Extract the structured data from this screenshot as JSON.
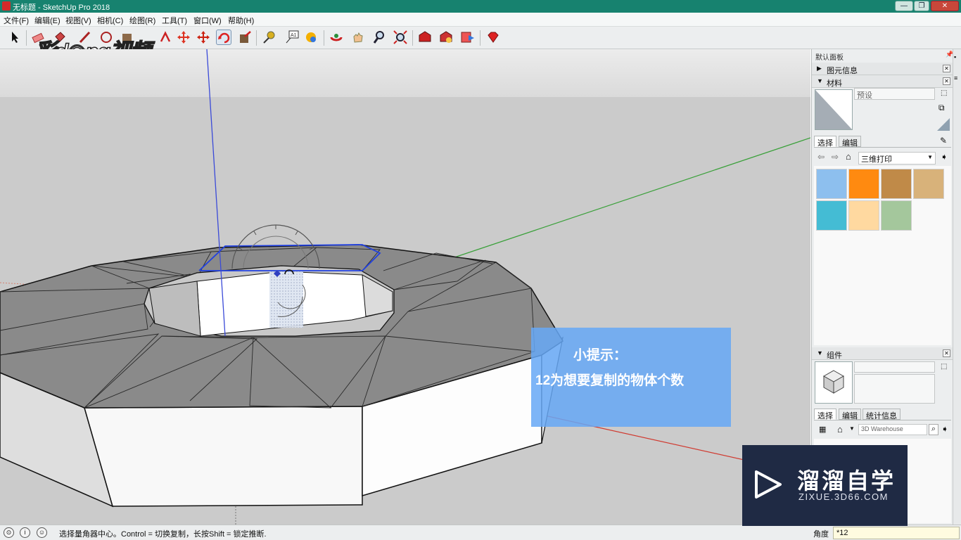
{
  "window": {
    "title": "无标题 - SketchUp Pro 2018",
    "controls": [
      "—",
      "❐",
      "✕"
    ]
  },
  "menu": [
    "文件(F)",
    "编辑(E)",
    "视图(V)",
    "相机(C)",
    "绘图(R)",
    "工具(T)",
    "窗口(W)",
    "帮助(H)"
  ],
  "toolbar": {
    "icons": [
      "select-icon",
      "eraser-icon",
      "paint-bucket-icon",
      "line-icon",
      "rectangle-icon",
      "push-pull-icon",
      "follow-me-icon",
      "move-icon",
      "rotate-icon",
      "scale-icon",
      "tape-measure-icon",
      "text-icon",
      "paint-icon",
      "orbit-icon",
      "pan-icon",
      "zoom-icon",
      "zoom-extents-icon",
      "warehouse-icon",
      "extension-warehouse-icon",
      "send-to-layout-icon",
      "ruby-icon"
    ],
    "active": "rotate-icon"
  },
  "watermark_top": "彩d◉ng视频",
  "tip": {
    "title": "小提示：",
    "text": "12为想要复制的物体个数"
  },
  "tray": {
    "title": "默认面板",
    "entity_info": {
      "label": "图元信息",
      "expanded": false
    },
    "materials": {
      "label": "材料",
      "expanded": true,
      "name_placeholder": "预设",
      "tabs": [
        "选择",
        "编辑"
      ],
      "selected_tab": "选择",
      "collection": "三维打印",
      "swatches": [
        "#8dbfee",
        "#ff8a10",
        "#c08a48",
        "#d8b27a",
        "#44bcd4",
        "#ffd9a0",
        "#a4c79c"
      ]
    },
    "components": {
      "label": "组件",
      "expanded": true,
      "tabs": [
        "选择",
        "编辑",
        "统计信息"
      ],
      "selected_tab": "选择",
      "search_placeholder": "3D Warehouse"
    }
  },
  "status": {
    "message": "选择量角器中心。Control = 切换复制，长按Shift = 锁定推断.",
    "vcb_label": "角度",
    "vcb_value": "*12"
  },
  "brand": {
    "name": "溜溜自学",
    "sub": "ZIXUE.3D66.COM"
  },
  "colors": {
    "titlebar": "#17826f",
    "tip_bg": "#66a8f6",
    "brand_bg": "#1f2a44",
    "axis_red": "#d03a30",
    "axis_green": "#3aa03a",
    "axis_blue": "#3a4ad8",
    "selection": "#2040e0"
  }
}
